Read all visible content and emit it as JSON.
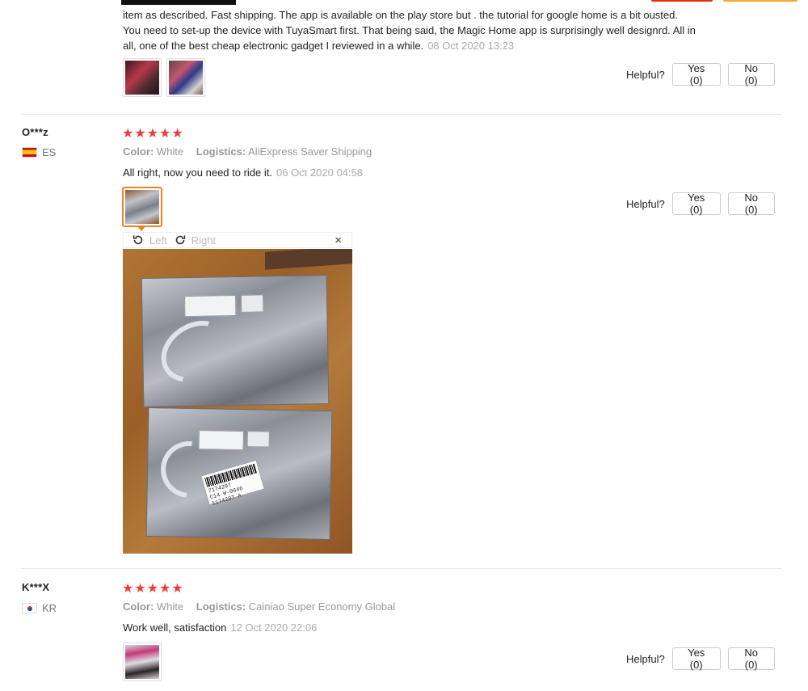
{
  "reviews": [
    {
      "text": "item as described. Fast shipping. The app is available on the play store but . the tutorial for google home is a bit ousted. You need to set-up the device with TuyaSmart first. That being said, the Magic Home app is surprisingly well designrd. All in all, one of the best cheap electronic gadget I reviewed in a while.",
      "date": "08 Oct 2020 13:23",
      "helpful_label": "Helpful?",
      "yes_label": "Yes (0)",
      "no_label": "No (0)"
    },
    {
      "user": "O***z",
      "country": "ES",
      "rating": 5,
      "color_label": "Color:",
      "color_value": "White",
      "logistics_label": "Logistics:",
      "logistics_value": "AliExpress Saver Shipping",
      "text": "All right, now you need to ride it.",
      "date": "06 Oct 2020 04:58",
      "helpful_label": "Helpful?",
      "yes_label": "Yes (0)",
      "no_label": "No (0)",
      "viewer": {
        "rotate_left": "Left",
        "rotate_right": "Right",
        "close": "×"
      }
    },
    {
      "user": "K***X",
      "country": "KR",
      "rating": 5,
      "color_label": "Color:",
      "color_value": "White",
      "logistics_label": "Logistics:",
      "logistics_value": "Cainiao Super Economy Global",
      "text": "Work well, satisfaction",
      "date": "12 Oct 2020 22:06",
      "helpful_label": "Helpful?",
      "yes_label": "Yes (0)",
      "no_label": "No (0)"
    }
  ],
  "photo_label": "7174207\nC14 W-0646\n1174207 A",
  "colors": {
    "star": "#f03c3c",
    "accent": "#f58020",
    "muted": "#999999"
  }
}
